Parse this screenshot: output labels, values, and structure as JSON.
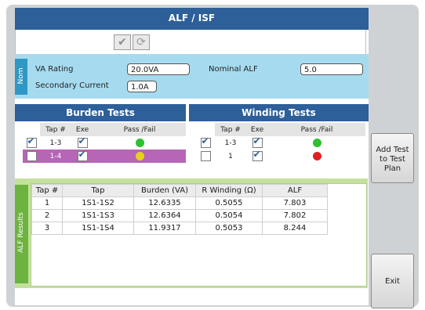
{
  "window": {
    "title": "ALF / ISF"
  },
  "toolbar": {
    "check_icon": "checkmark-icon",
    "reload_icon": "refresh-icon"
  },
  "nominal": {
    "tab_label": "Nom",
    "va_rating_label": "VA Rating",
    "va_rating_value": "20.0VA",
    "secondary_current_label": "Secondary Current",
    "secondary_current_value": "1.0A",
    "nominal_alf_label": "Nominal ALF",
    "nominal_alf_value": "5.0"
  },
  "burden_tests": {
    "title": "Burden Tests",
    "headers": {
      "tap": "Tap #",
      "exe": "Exe",
      "pass_fail": "Pass /Fail"
    },
    "rows": [
      {
        "tap": "1-3",
        "checked": true,
        "exe": true,
        "status": "green"
      },
      {
        "tap": "1-4",
        "checked": false,
        "exe": true,
        "status": "yellow"
      }
    ]
  },
  "winding_tests": {
    "title": "Winding Tests",
    "headers": {
      "tap": "Tap #",
      "exe": "Exe",
      "pass_fail": "Pass /Fail"
    },
    "rows": [
      {
        "tap": "1-3",
        "checked": true,
        "exe": true,
        "status": "green"
      },
      {
        "tap": "1",
        "checked": false,
        "exe": true,
        "status": "red"
      }
    ]
  },
  "results": {
    "tab_label": "ALF Results",
    "headers": {
      "tap_no": "Tap #",
      "tap": "Tap",
      "burden": "Burden (VA)",
      "r_winding": "R Winding (Ω)",
      "alf": "ALF"
    },
    "rows": [
      {
        "tap_no": "1",
        "tap": "1S1-1S2",
        "burden": "12.6335",
        "r_winding": "0.5055",
        "alf": "7.803"
      },
      {
        "tap_no": "2",
        "tap": "1S1-1S3",
        "burden": "12.6364",
        "r_winding": "0.5054",
        "alf": "7.802"
      },
      {
        "tap_no": "3",
        "tap": "1S1-1S4",
        "burden": "11.9317",
        "r_winding": "0.5053",
        "alf": "8.244"
      }
    ]
  },
  "buttons": {
    "add_test": "Add Test to Test Plan",
    "exit": "Exit"
  },
  "colors": {
    "green": "#2fbf2f",
    "yellow": "#e6d21a",
    "red": "#e02020",
    "accent": "#2d5f99"
  }
}
